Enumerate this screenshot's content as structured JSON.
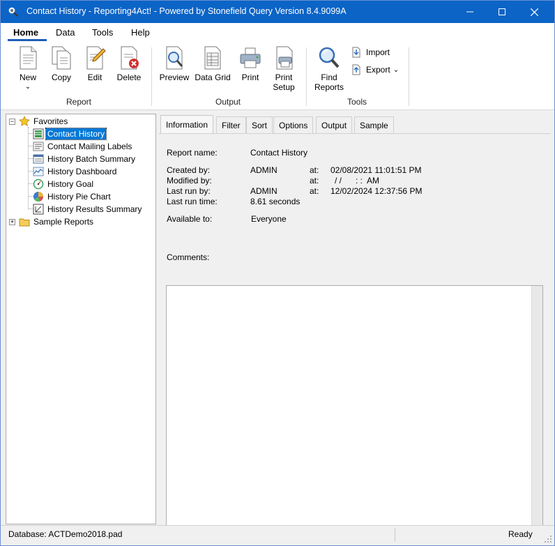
{
  "window": {
    "title": "Contact History - Reporting4Act! - Powered by Stonefield Query Version 8.4.9099A"
  },
  "ribbon_tabs": [
    {
      "label": "Home",
      "active": true
    },
    {
      "label": "Data"
    },
    {
      "label": "Tools"
    },
    {
      "label": "Help"
    }
  ],
  "ribbon": {
    "report_group": "Report",
    "output_group": "Output",
    "tools_group": "Tools",
    "new": "New",
    "new_arrow": "⌄",
    "copy": "Copy",
    "edit": "Edit",
    "delete": "Delete",
    "preview": "Preview",
    "data_grid": "Data Grid",
    "print": "Print",
    "print_setup_1": "Print",
    "print_setup_2": "Setup",
    "find_reports_1": "Find",
    "find_reports_2": "Reports",
    "import": "Import",
    "export": "Export",
    "export_arrow": "⌄"
  },
  "tree": {
    "favorites": "Favorites",
    "items": [
      {
        "label": "Contact History",
        "icon": "report-grid-icon",
        "selected": true
      },
      {
        "label": "Contact Mailing Labels",
        "icon": "labels-icon"
      },
      {
        "label": "History Batch Summary",
        "icon": "batch-report-icon"
      },
      {
        "label": "History Dashboard",
        "icon": "dashboard-icon"
      },
      {
        "label": "History Goal",
        "icon": "goal-gauge-icon"
      },
      {
        "label": "History Pie Chart",
        "icon": "pie-chart-icon"
      },
      {
        "label": "History Results Summary",
        "icon": "results-summary-icon"
      }
    ],
    "sample_reports": "Sample Reports"
  },
  "panel_tabs": [
    {
      "label": "Information",
      "active": true
    },
    {
      "label": "Filter"
    },
    {
      "label": "Sort"
    },
    {
      "label": "Options"
    },
    {
      "label": "Output"
    },
    {
      "label": "Sample"
    }
  ],
  "info": {
    "report_name_label": "Report name:",
    "report_name": "Contact History",
    "created_by_label": "Created by:",
    "created_by": "ADMIN",
    "created_at_label": "at:",
    "created_at": "02/08/2021 11:01:51 PM",
    "modified_by_label": "Modified by:",
    "modified_by": "",
    "modified_at_label": "at:",
    "modified_at": "/ /      : :  AM",
    "last_run_by_label": "Last run by:",
    "last_run_by": "ADMIN",
    "last_run_at_label": "at:",
    "last_run_at": "12/02/2024 12:37:56 PM",
    "last_run_time_label": "Last run time:",
    "last_run_time": "8.61 seconds",
    "available_to_label": "Available to:",
    "available_to": "Everyone",
    "comments_label": "Comments:",
    "comments": ""
  },
  "status": {
    "database": "Database: ACTDemo2018.pad",
    "state": "Ready"
  }
}
